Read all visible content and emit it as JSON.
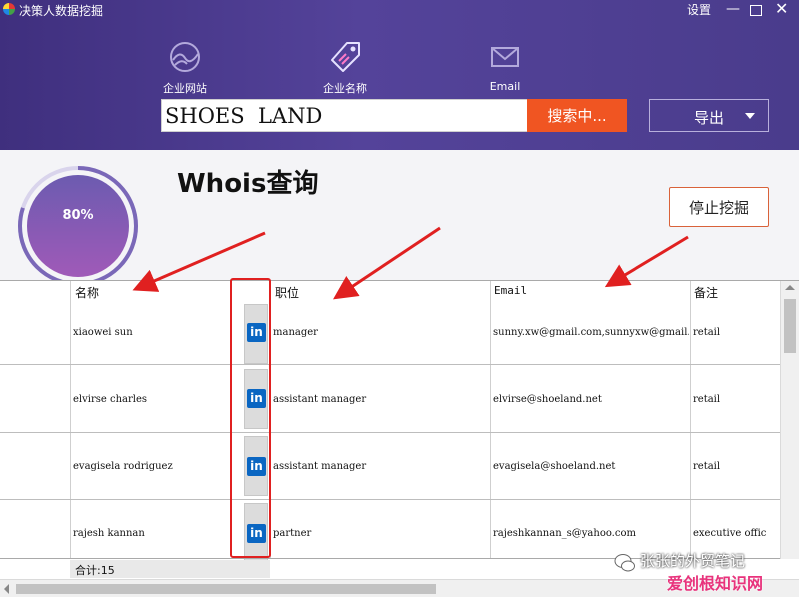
{
  "window": {
    "title": "决策人数据挖掘",
    "settings": "设置",
    "minimize": "—",
    "close": "✕"
  },
  "nav": {
    "tabs": [
      {
        "label": "企业网站",
        "icon": "globe-icon"
      },
      {
        "label": "企业名称",
        "icon": "tag-icon",
        "active": true
      },
      {
        "label": "Email",
        "icon": "mail-icon"
      }
    ]
  },
  "search": {
    "value": "SHOES  LAND",
    "button": "搜索中...",
    "export": "导出"
  },
  "status": {
    "progress": "80%",
    "progress_value": 0.8,
    "title": "Whois查询",
    "stop": "停止挖掘"
  },
  "table": {
    "headers": {
      "name": "名称",
      "position": "职位",
      "email": "Email",
      "note": "备注"
    },
    "linkedin_label": "in",
    "rows": [
      {
        "name": "xiaowei sun",
        "position": "manager",
        "email": "sunny.xw@gmail.com,sunnyxw@gmail.",
        "note": "retail"
      },
      {
        "name": "elvirse charles",
        "position": "assistant manager",
        "email": "elvirse@shoeland.net",
        "note": "retail"
      },
      {
        "name": "evagisela rodriguez",
        "position": "assistant manager",
        "email": "evagisela@shoeland.net",
        "note": "retail"
      },
      {
        "name": "rajesh kannan",
        "position": "partner",
        "email": "rajeshkannan_s@yahoo.com",
        "note": "executive offic"
      }
    ],
    "total": "合计:15"
  },
  "watermark": {
    "line1": "张张的外贸笔记",
    "line2": "爱创根知识网"
  },
  "colors": {
    "header": "#4a3c8c",
    "accent": "#f05522",
    "linkedin": "#0a66c2",
    "annotation": "#e02020"
  }
}
